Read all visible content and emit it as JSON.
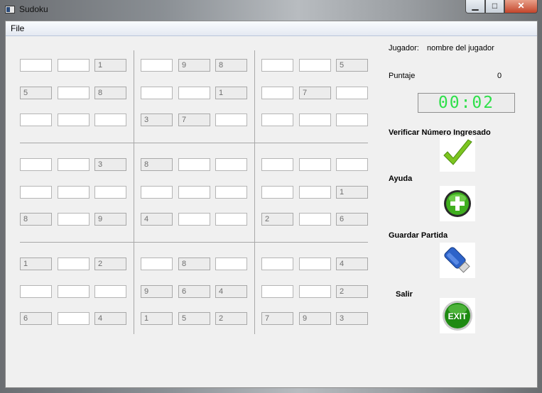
{
  "window": {
    "title": "Sudoku",
    "minimize": "▁",
    "maximize": "□",
    "close": "✕"
  },
  "menu": {
    "file": "File"
  },
  "board": {
    "rows": [
      [
        "",
        "",
        "1",
        "",
        "9",
        "8",
        "",
        "",
        "5"
      ],
      [
        "5",
        "",
        "8",
        "",
        "",
        "1",
        "",
        "7",
        ""
      ],
      [
        "",
        "",
        "",
        "3",
        "7",
        "",
        "",
        "",
        ""
      ],
      [
        "",
        "",
        "3",
        "8",
        "",
        "",
        "",
        "",
        ""
      ],
      [
        "",
        "",
        "",
        "",
        "",
        "",
        "",
        "",
        "1"
      ],
      [
        "8",
        "",
        "9",
        "4",
        "",
        "",
        "2",
        "",
        "6"
      ],
      [
        "1",
        "",
        "2",
        "",
        "8",
        "",
        "",
        "",
        "4"
      ],
      [
        "",
        "",
        "",
        "9",
        "6",
        "4",
        "",
        "",
        "2"
      ],
      [
        "6",
        "",
        "4",
        "1",
        "5",
        "2",
        "7",
        "9",
        "3"
      ]
    ],
    "editable": [
      [
        1,
        1,
        0,
        1,
        0,
        0,
        1,
        1,
        0
      ],
      [
        0,
        1,
        0,
        1,
        1,
        0,
        1,
        0,
        1
      ],
      [
        1,
        1,
        1,
        0,
        0,
        1,
        1,
        1,
        1
      ],
      [
        1,
        1,
        0,
        0,
        1,
        1,
        1,
        1,
        1
      ],
      [
        1,
        1,
        1,
        1,
        1,
        1,
        1,
        1,
        0
      ],
      [
        0,
        1,
        0,
        0,
        1,
        1,
        0,
        1,
        0
      ],
      [
        0,
        1,
        0,
        1,
        0,
        1,
        1,
        1,
        0
      ],
      [
        1,
        1,
        1,
        0,
        0,
        0,
        1,
        1,
        0
      ],
      [
        0,
        1,
        0,
        0,
        0,
        0,
        0,
        0,
        0
      ]
    ]
  },
  "side": {
    "player_label": "Jugador:",
    "player_name": "nombre del jugador",
    "score_label": "Puntaje",
    "score_value": "0",
    "timer": "00:02",
    "verify_label": "Verificar Número Ingresado",
    "help_label": "Ayuda",
    "save_label": "Guardar Partida",
    "exit_label": "Salir",
    "exit_icon_text": "EXIT"
  },
  "colors": {
    "timer_digits": "#2ee04a",
    "check": "#7cc520",
    "help": "#3fae1e",
    "exit": "#1e8a12",
    "save": "#2d63c9"
  }
}
